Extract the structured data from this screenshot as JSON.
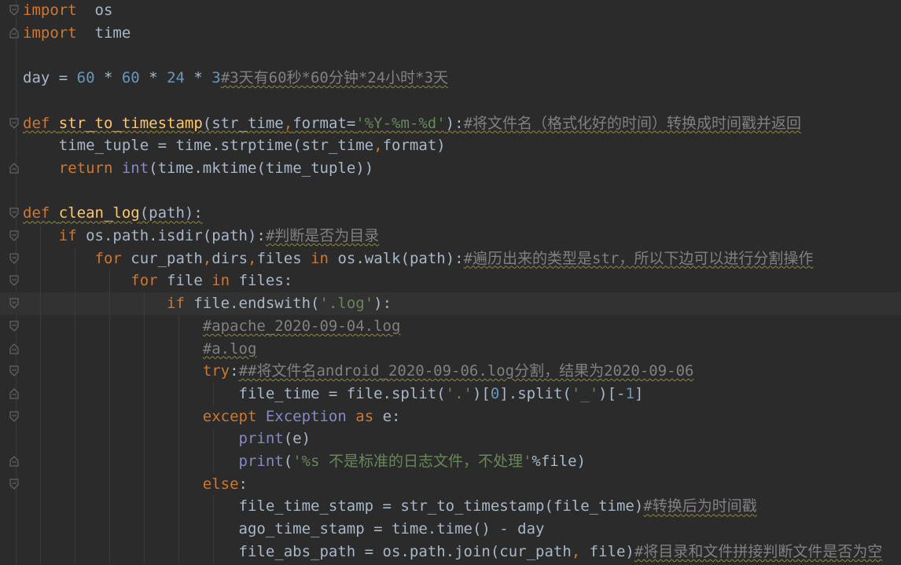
{
  "editor": {
    "lines": [
      {
        "id": "l1",
        "tokens": [
          [
            "kw",
            "import"
          ],
          [
            "",
            "  os"
          ]
        ]
      },
      {
        "id": "l2",
        "tokens": [
          [
            "kw",
            "import"
          ],
          [
            "",
            "  time"
          ]
        ]
      },
      {
        "id": "l3",
        "tokens": []
      },
      {
        "id": "l4",
        "tokens": [
          [
            "",
            "day = "
          ],
          [
            "num",
            "60"
          ],
          [
            "",
            " * "
          ],
          [
            "num",
            "60"
          ],
          [
            "",
            " * "
          ],
          [
            "num",
            "24"
          ],
          [
            "",
            " * "
          ],
          [
            "num",
            "3"
          ],
          [
            "cmt squig",
            "#3天有60秒*60分钟*24小时*3天"
          ]
        ]
      },
      {
        "id": "l5",
        "tokens": []
      },
      {
        "id": "l6",
        "tokens": [
          [
            "kw squig",
            "def "
          ],
          [
            "fn squig",
            "str_to_timestamp"
          ],
          [
            "squig",
            "(str_time"
          ],
          [
            "kw squig",
            ","
          ],
          [
            "squig",
            "format="
          ],
          [
            "str squig",
            "'%Y-%m-%d'"
          ],
          [
            "squig",
            "):"
          ],
          [
            "cmt squig",
            "#将文件名（格式化好的时间）转换成时间戳并返回"
          ]
        ]
      },
      {
        "id": "l7",
        "tokens": [
          [
            "",
            "    time_tuple = time.strptime(str_time"
          ],
          [
            "kw",
            ","
          ],
          [
            "",
            "format)"
          ]
        ]
      },
      {
        "id": "l8",
        "tokens": [
          [
            "kw",
            "    return "
          ],
          [
            "builtin",
            "int"
          ],
          [
            "",
            "(time.mktime(time_tuple))"
          ]
        ]
      },
      {
        "id": "l9",
        "tokens": []
      },
      {
        "id": "l10",
        "tokens": [
          [
            "kw squig",
            "def "
          ],
          [
            "fn squig",
            "clean_log"
          ],
          [
            "squig",
            "(path):"
          ]
        ]
      },
      {
        "id": "l11",
        "tokens": [
          [
            "kw",
            "    if "
          ],
          [
            "",
            "os.path.isdir(path):"
          ],
          [
            "cmt squig",
            "#判断是否为目录"
          ]
        ]
      },
      {
        "id": "l12",
        "tokens": [
          [
            "kw",
            "        for "
          ],
          [
            "",
            "cur_path"
          ],
          [
            "kw",
            ","
          ],
          [
            "",
            "dirs"
          ],
          [
            "kw",
            ","
          ],
          [
            "",
            "files "
          ],
          [
            "kw",
            "in "
          ],
          [
            "",
            "os.walk(path):"
          ],
          [
            "cmt squig",
            "#遍历出来的类型是str，所以下边可以进行分割操作"
          ]
        ]
      },
      {
        "id": "l13",
        "tokens": [
          [
            "kw",
            "            for "
          ],
          [
            "",
            "file "
          ],
          [
            "kw",
            "in "
          ],
          [
            "",
            "files:"
          ]
        ]
      },
      {
        "id": "l14",
        "tokens": [
          [
            "kw",
            "                if "
          ],
          [
            "",
            "file.endswith("
          ],
          [
            "str",
            "'.log'"
          ],
          [
            "",
            "):"
          ]
        ]
      },
      {
        "id": "l15",
        "tokens": [
          [
            "cmt",
            "                    "
          ],
          [
            "cmt squig",
            "#apache_2020-09-04.log"
          ]
        ]
      },
      {
        "id": "l16",
        "tokens": [
          [
            "cmt",
            "                    "
          ],
          [
            "cmt squig",
            "#a.log"
          ]
        ]
      },
      {
        "id": "l17",
        "tokens": [
          [
            "kw",
            "                    try"
          ],
          [
            ":",
            ":"
          ],
          [
            "cmt squig",
            "##将文件名android_2020-09-06.log分割，结果为2020-09-06"
          ]
        ]
      },
      {
        "id": "l18",
        "tokens": [
          [
            "",
            "                        file_time = file.split("
          ],
          [
            "str",
            "'.'"
          ],
          [
            "",
            ")["
          ],
          [
            "num",
            "0"
          ],
          [
            "",
            "].split("
          ],
          [
            "str",
            "'_'"
          ],
          [
            "",
            ")[-"
          ],
          [
            "num",
            "1"
          ],
          [
            "",
            "]"
          ]
        ]
      },
      {
        "id": "l19",
        "tokens": [
          [
            "kw",
            "                    except "
          ],
          [
            "builtin",
            "Exception "
          ],
          [
            "kw",
            "as "
          ],
          [
            "",
            "e:"
          ]
        ]
      },
      {
        "id": "l20",
        "tokens": [
          [
            "builtin",
            "                        print"
          ],
          [
            "",
            "(e)"
          ]
        ]
      },
      {
        "id": "l21",
        "tokens": [
          [
            "builtin",
            "                        print"
          ],
          [
            "",
            "("
          ],
          [
            "str",
            "'%s 不是标准的日志文件，不处理'"
          ],
          [
            "",
            "%file)"
          ]
        ]
      },
      {
        "id": "l22",
        "tokens": [
          [
            "kw",
            "                    else"
          ],
          [
            "",
            ":"
          ]
        ]
      },
      {
        "id": "l23",
        "tokens": [
          [
            "",
            "                        file_time_stamp = str_to_timestamp(file_time)"
          ],
          [
            "cmt squig",
            "#转换后为时间戳"
          ]
        ]
      },
      {
        "id": "l24",
        "tokens": [
          [
            "",
            "                        ago_time_stamp = time.time() - day"
          ]
        ]
      },
      {
        "id": "l25",
        "tokens": [
          [
            "",
            "                        file_abs_path = os.path.join(cur_path"
          ],
          [
            "kw",
            ","
          ],
          [
            "",
            " file)"
          ],
          [
            "cmt squig",
            "#将目录和文件拼接判断文件是否为空"
          ]
        ]
      }
    ],
    "current_line": "l14"
  },
  "icons": {
    "fold_open": "fold-open-icon",
    "fold_close": "fold-close-icon"
  },
  "colors": {
    "background": "#2b2b2b",
    "keyword": "#cc7832",
    "function": "#ffc66d",
    "number": "#6897bb",
    "string": "#6a8759",
    "comment": "#808080",
    "builtin": "#8888c6",
    "text": "#a9b7c6"
  }
}
